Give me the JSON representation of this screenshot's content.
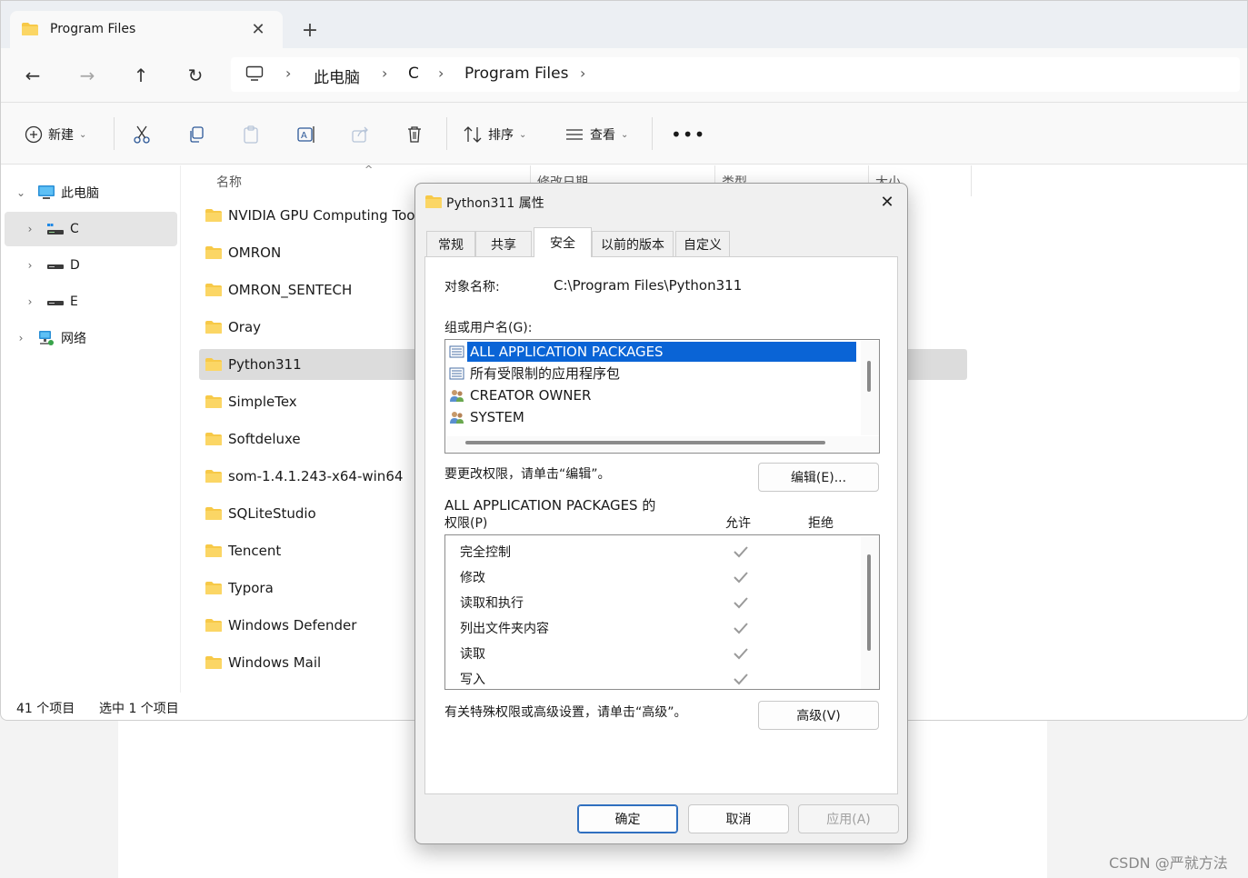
{
  "explorer": {
    "tab_title": "Program Files",
    "breadcrumb": [
      "此电脑",
      "C",
      "Program Files"
    ],
    "toolbar": {
      "new_label": "新建",
      "sort_label": "排序",
      "view_label": "查看"
    },
    "sidebar": {
      "items": [
        {
          "label": "此电脑",
          "icon": "monitor-icon"
        },
        {
          "label": "C",
          "icon": "drive-c-icon"
        },
        {
          "label": "D",
          "icon": "drive-icon"
        },
        {
          "label": "E",
          "icon": "drive-icon"
        },
        {
          "label": "网络",
          "icon": "network-icon"
        }
      ]
    },
    "columns": [
      "名称",
      "修改日期",
      "类型",
      "大小"
    ],
    "rows": [
      "NVIDIA GPU Computing Tool",
      "OMRON",
      "OMRON_SENTECH",
      "Oray",
      "Python311",
      "SimpleTex",
      "Softdeluxe",
      "som-1.4.1.243-x64-win64",
      "SQLiteStudio",
      "Tencent",
      "Typora",
      "Windows Defender",
      "Windows Mail"
    ],
    "selected_row": "Python311",
    "status": {
      "count": "41 个项目",
      "selected": "选中 1 个项目"
    }
  },
  "dialog": {
    "title": "Python311 属性",
    "tabs": [
      "常规",
      "共享",
      "安全",
      "以前的版本",
      "自定义"
    ],
    "active_tab": "安全",
    "object_label": "对象名称:",
    "object_value": "C:\\Program Files\\Python311",
    "groups_label": "组或用户名(G):",
    "groups": [
      {
        "name": "ALL APPLICATION PACKAGES",
        "icon": "app-package-icon",
        "selected": true
      },
      {
        "name": "所有受限制的应用程序包",
        "icon": "app-package-icon",
        "selected": false
      },
      {
        "name": "CREATOR OWNER",
        "icon": "users-icon",
        "selected": false
      },
      {
        "name": "SYSTEM",
        "icon": "users-icon",
        "selected": false
      }
    ],
    "change_hint": "要更改权限，请单击“编辑”。",
    "edit_button": "编辑(E)...",
    "perm_title_line1": "ALL APPLICATION PACKAGES 的",
    "perm_title_line2": "权限(P)",
    "allow_label": "允许",
    "deny_label": "拒绝",
    "permissions": [
      {
        "name": "完全控制",
        "allow": true
      },
      {
        "name": "修改",
        "allow": true
      },
      {
        "name": "读取和执行",
        "allow": true
      },
      {
        "name": "列出文件夹内容",
        "allow": true
      },
      {
        "name": "读取",
        "allow": true
      },
      {
        "name": "写入",
        "allow": true
      }
    ],
    "advanced_hint": "有关特殊权限或高级设置，请单击“高级”。",
    "advanced_button": "高级(V)",
    "ok_button": "确定",
    "cancel_button": "取消",
    "apply_button": "应用(A)"
  },
  "watermark": "CSDN @严就方法",
  "colors": {
    "selection": "#0a64d6",
    "folder": "#f7c948",
    "check": "#9a9a9a"
  }
}
